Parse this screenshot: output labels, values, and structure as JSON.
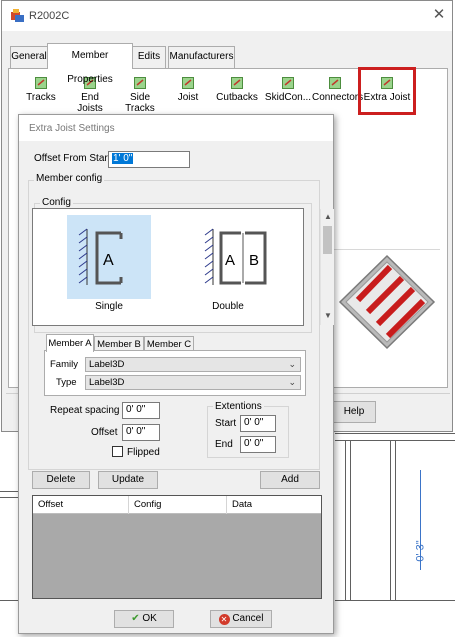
{
  "window": {
    "title": "R2002C",
    "close_glyph": "✕",
    "tabs": [
      "General",
      "Member Properties",
      "Edits",
      "Manufacturers"
    ],
    "tools": [
      "Tracks",
      "End Joists",
      "Side Tracks",
      "Joist",
      "Cutbacks",
      "SkidCon...",
      "Connectors",
      "Extra Joist"
    ],
    "help_label": "Help",
    "highlight_color": "#cc1f1f"
  },
  "dialog": {
    "title": "Extra Joist Settings",
    "offset_from_start_label": "Offset From Start",
    "offset_from_start_value": "1' 0\"",
    "member_config_label": "Member config",
    "config_label": "Config",
    "options": [
      {
        "name": "Single",
        "letters": [
          "A"
        ],
        "selected": true
      },
      {
        "name": "Double",
        "letters": [
          "A",
          "B"
        ],
        "selected": false
      }
    ],
    "member_tabs": [
      "Member A",
      "Member B",
      "Member C"
    ],
    "family_label": "Family",
    "family_value": "Label3D",
    "type_label": "Type",
    "type_value": "Label3D",
    "repeat_spacing_label": "Repeat spacing",
    "repeat_spacing_value": "0' 0\"",
    "offset_label": "Offset",
    "offset_value": "0' 0\"",
    "flipped_label": "Flipped",
    "flipped_checked": false,
    "extentions_label": "Extentions",
    "start_label": "Start",
    "start_value": "0' 0\"",
    "end_label": "End",
    "end_value": "0' 0\"",
    "buttons": {
      "delete": "Delete",
      "update": "Update",
      "add": "Add",
      "ok": "OK",
      "cancel": "Cancel"
    },
    "grid_columns": [
      "Offset",
      "Config",
      "Data"
    ]
  },
  "drawing": {
    "dimension_text": "0' 3\"",
    "accent": "#cc1f1f"
  }
}
